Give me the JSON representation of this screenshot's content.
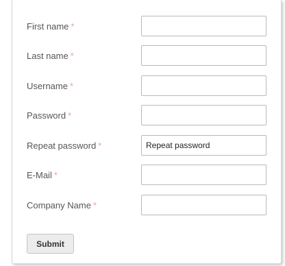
{
  "form": {
    "required_marker": "*",
    "fields": [
      {
        "label": "First name",
        "value": "",
        "placeholder": ""
      },
      {
        "label": "Last name",
        "value": "",
        "placeholder": ""
      },
      {
        "label": "Username",
        "value": "",
        "placeholder": ""
      },
      {
        "label": "Password",
        "value": "",
        "placeholder": ""
      },
      {
        "label": "Repeat password",
        "value": "",
        "placeholder": "Repeat password"
      },
      {
        "label": "E-Mail",
        "value": "",
        "placeholder": ""
      },
      {
        "label": "Company Name",
        "value": "",
        "placeholder": ""
      }
    ],
    "submit_label": "Submit"
  },
  "colors": {
    "required_marker": "#e8a3a3",
    "label_text": "#555555",
    "input_border": "#b9b9b9",
    "button_background": "#ececec"
  }
}
